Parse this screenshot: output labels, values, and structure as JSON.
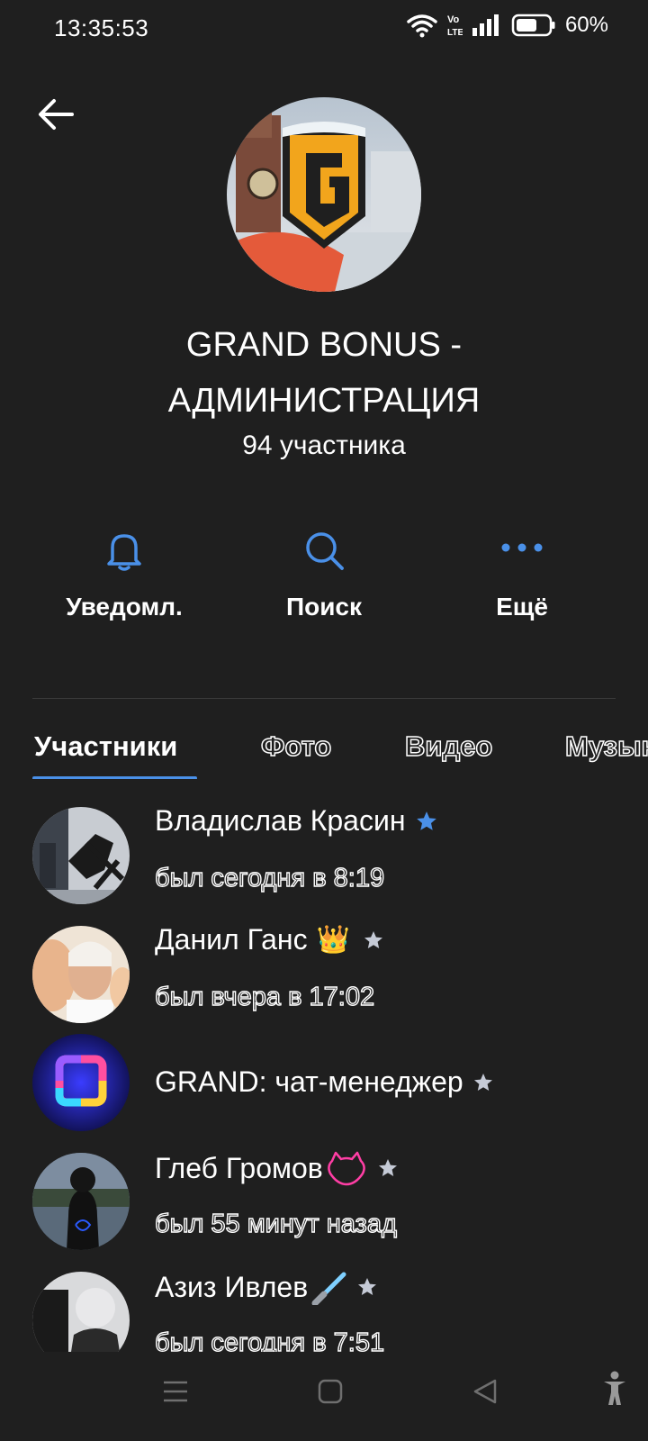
{
  "status_bar": {
    "time": "13:35:53",
    "battery": "60%",
    "icons": [
      "wifi-icon",
      "volte-icon",
      "signal-icon",
      "battery-icon"
    ]
  },
  "header": {
    "back_icon": "arrow-left-icon",
    "title_line1": "GRAND BONUS -",
    "title_line2": "АДМИНИСТРАЦИЯ",
    "members_count": "94 участника"
  },
  "actions": [
    {
      "label": "Уведомл.",
      "icon": "bell-icon"
    },
    {
      "label": "Поиск",
      "icon": "search-icon"
    },
    {
      "label": "Ещё",
      "icon": "more-dots-icon"
    }
  ],
  "tabs": [
    {
      "label": "Участники",
      "active": true
    },
    {
      "label": "Фото",
      "active": false
    },
    {
      "label": "Видео",
      "active": false
    },
    {
      "label": "Музыка",
      "active": false
    }
  ],
  "members": [
    {
      "name": "Владислав Красин",
      "status": "был сегодня в 8:19",
      "badge": "star-blue-icon"
    },
    {
      "name": "Данил Ганс",
      "status": "был вчера в 17:02",
      "emoji": "👑",
      "badge": "star-gray-icon"
    },
    {
      "name": "GRAND: чат-менеджер",
      "status": "",
      "badge": "star-gray-icon"
    },
    {
      "name": "Глеб Громов",
      "status": "был 55 минут назад",
      "badge": "star-gray-icon"
    },
    {
      "name": "Азиз Ивлев",
      "status": "был сегодня в 7:51",
      "badge": "star-gray-icon"
    }
  ],
  "colors": {
    "background": "#1f1f1f",
    "accent": "#4a90e8",
    "star_gray": "#c5cad6"
  },
  "nav_bar": [
    "menu-icon",
    "home-icon",
    "back-triangle-icon",
    "accessibility-icon"
  ]
}
